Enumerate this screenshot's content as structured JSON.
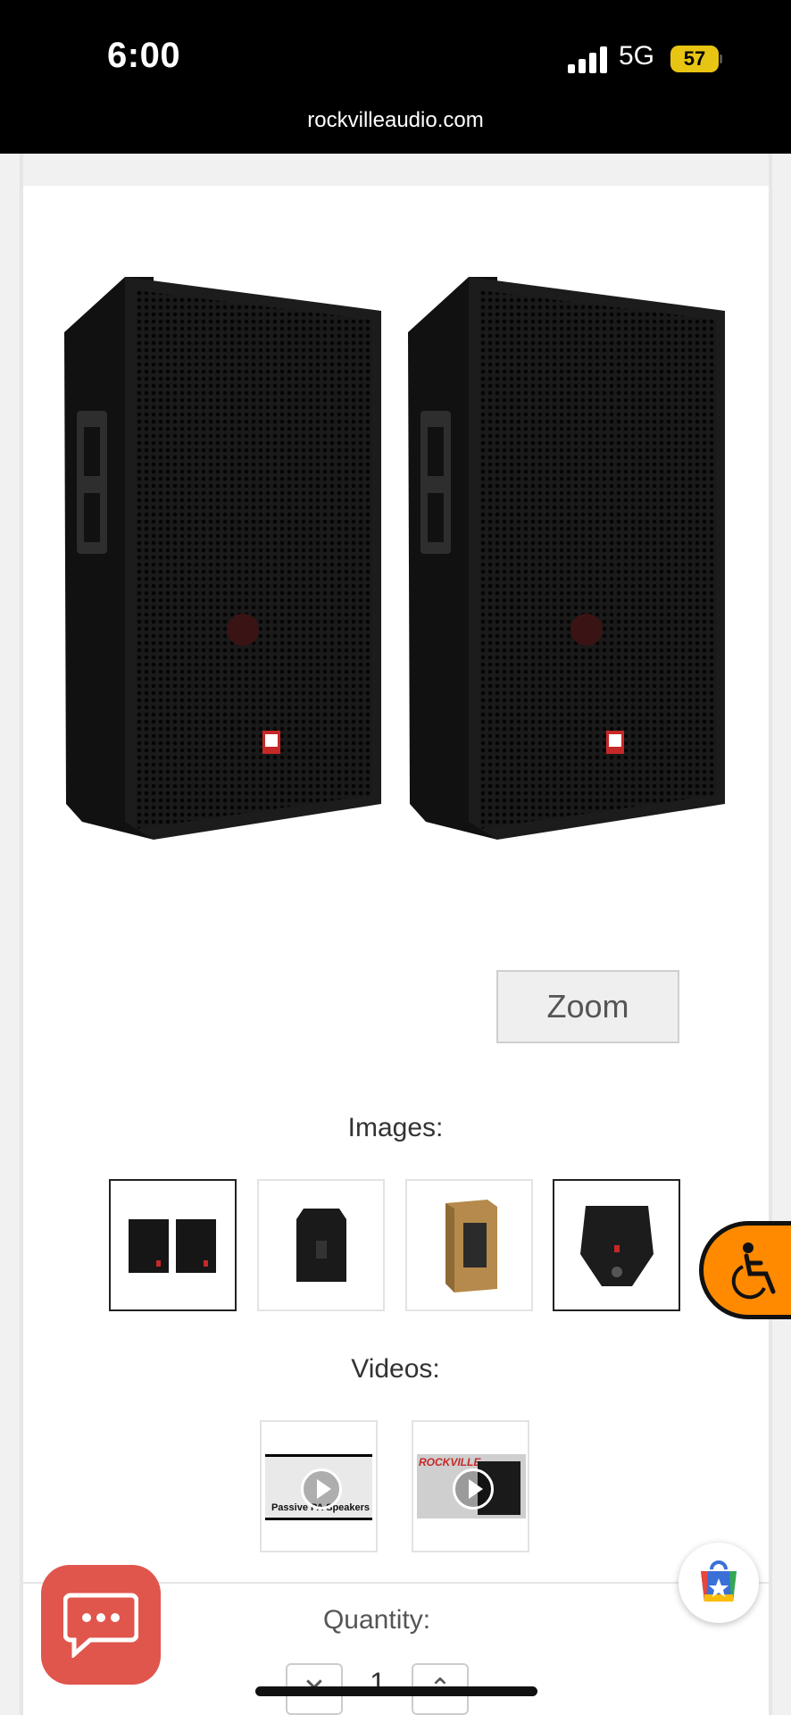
{
  "status_bar": {
    "time": "6:00",
    "network": "5G",
    "battery": "57",
    "url": "rockvilleaudio.com"
  },
  "product": {
    "zoom_label": "Zoom",
    "images_label": "Images:",
    "videos_label": "Videos:",
    "image_thumbnails": [
      {
        "alt": "pair of speakers front",
        "selected": true
      },
      {
        "alt": "speaker side view",
        "selected": false
      },
      {
        "alt": "speaker box packaging",
        "selected": false
      },
      {
        "alt": "speaker top view",
        "selected": true
      }
    ],
    "videos": [
      {
        "alt": "video thumbnail passive PA speakers",
        "caption": "Passive PA Speakers"
      },
      {
        "alt": "video thumbnail Rockville RSG15",
        "caption": "ROCKVILLE"
      }
    ]
  },
  "quantity": {
    "label": "Quantity:",
    "value": "1",
    "decrement_icon": "x-icon",
    "increment_icon": "chevron-up-icon"
  },
  "floating": {
    "accessibility_icon": "wheelchair-icon",
    "chat_icon": "chat-bubble-icon",
    "shop_icon": "shopping-bag-star-icon"
  },
  "colors": {
    "accessibility": "#ff8a00",
    "chat": "#e0564d",
    "battery": "#e8c513"
  }
}
